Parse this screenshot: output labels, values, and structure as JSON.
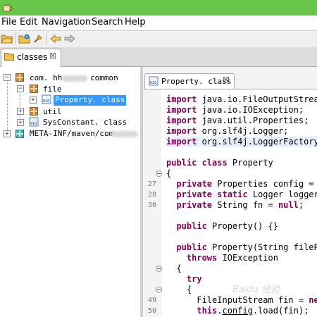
{
  "menu": [
    "File",
    "Edit",
    "Navigation",
    "Search",
    "Help"
  ],
  "left_tab": {
    "label": "classes",
    "close": "☒"
  },
  "tree": {
    "root": {
      "prefix": "com. hh.",
      "suffix": "common"
    },
    "file_pkg": "file",
    "selected_class": "Property. class",
    "util_pkg": "util",
    "sysconstant": "SysConstant. class",
    "metainf": "META-INF/maven/com"
  },
  "editor": {
    "tab_label": "Property. class",
    "tab_close": "☒",
    "lines": [
      {
        "num": "",
        "text": "import java.io.FileOutputStream"
      },
      {
        "num": "",
        "text": "import java.io.IOException;"
      },
      {
        "num": "",
        "text": "import java.util.Properties;"
      },
      {
        "num": "",
        "text": "import org.slf4j.Logger;"
      },
      {
        "num": "",
        "text": "import org.slf4j.LoggerFactory;"
      },
      {
        "num": "",
        "text": "public class Property"
      },
      {
        "num": "",
        "text": "{"
      },
      {
        "num": "27",
        "text": "  private Properties config = n"
      },
      {
        "num": "28",
        "text": "  private static Logger logger"
      },
      {
        "num": "30",
        "text": "  private String fn = null;"
      },
      {
        "num": "",
        "text": "  public Property() {}"
      },
      {
        "num": "",
        "text": "  public Property(String filePa"
      },
      {
        "num": "",
        "text": "    throws IOException"
      },
      {
        "num": "",
        "text": "  {"
      },
      {
        "num": "",
        "text": "    try"
      },
      {
        "num": "",
        "text": "    {"
      },
      {
        "num": "49",
        "text": "      FileInputStream fin = new"
      },
      {
        "num": "50",
        "text": "      this.config.load(fin);"
      }
    ]
  },
  "watermark": "Baidu 经验",
  "colors": {
    "titlebar": "#69c44a",
    "keyword": "#7f0055",
    "selection": "#3399ff"
  }
}
